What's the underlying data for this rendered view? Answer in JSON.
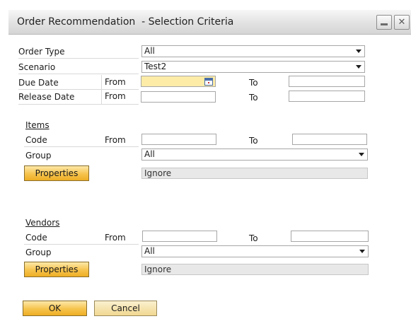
{
  "window": {
    "title": "Order Recommendation  - Selection Criteria",
    "minimize_glyph": "",
    "close_glyph": "✕"
  },
  "criteria": {
    "order_type": {
      "label": "Order Type",
      "value": "All"
    },
    "scenario": {
      "label": "Scenario",
      "value": "Test2"
    },
    "due_date": {
      "label": "Due Date",
      "from_label": "From",
      "from_value": "",
      "to_label": "To",
      "to_value": ""
    },
    "release_date": {
      "label": "Release Date",
      "from_label": "From",
      "from_value": "",
      "to_label": "To",
      "to_value": ""
    }
  },
  "items": {
    "section_label": "Items",
    "code_label": "Code",
    "from_label": "From",
    "to_label": "To",
    "group_label": "Group",
    "group_value": "All",
    "properties_label": "Properties",
    "properties_value": "Ignore"
  },
  "vendors": {
    "section_label": "Vendors",
    "code_label": "Code",
    "from_label": "From",
    "to_label": "To",
    "group_label": "Group",
    "group_value": "All",
    "properties_label": "Properties",
    "properties_value": "Ignore"
  },
  "buttons": {
    "ok": "OK",
    "cancel": "Cancel"
  },
  "colors": {
    "button_gold": "#f6c34d",
    "due_from_highlight": "#fdeca8"
  },
  "icons": {
    "calendar": "calendar-icon",
    "dropdown": "chevron-down-icon"
  }
}
